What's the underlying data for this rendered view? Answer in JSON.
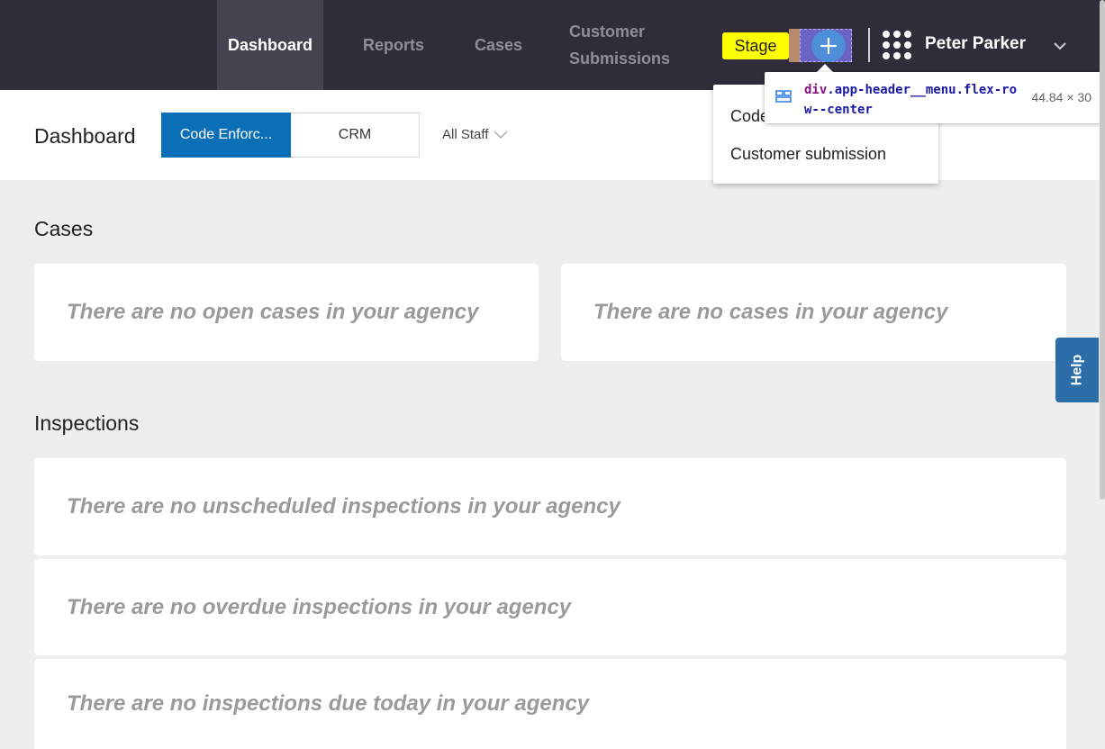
{
  "header": {
    "nav": [
      {
        "label": "Dashboard",
        "active": true
      },
      {
        "label": "Reports"
      },
      {
        "label": "Cases"
      },
      {
        "label_line1": "Customer",
        "label_line2": "Submissions"
      }
    ],
    "stage_label": "Stage",
    "user_name": "Peter Parker",
    "icons": [
      "plus-icon",
      "apps-grid-icon",
      "chevron-down-icon"
    ]
  },
  "subbar": {
    "title": "Dashboard",
    "segments": [
      "Code Enforc...",
      "CRM"
    ],
    "staff_filter": "All Staff"
  },
  "add_menu": {
    "items": [
      "Code",
      "Customer submission"
    ]
  },
  "devtools_tooltip": {
    "tag": "div",
    "selector": ".app-header__menu.flex-row--center",
    "dimensions": "44.84 × 30"
  },
  "sections": {
    "cases": {
      "title": "Cases",
      "cards": [
        "There are no open cases in your agency",
        "There are no cases in your agency"
      ]
    },
    "inspections": {
      "title": "Inspections",
      "cards": [
        "There are no unscheduled inspections in your agency",
        "There are no overdue inspections in your agency",
        "There are no inspections due today in your agency"
      ]
    }
  },
  "help_label": "Help",
  "colors": {
    "header_bg": "#2f2d3a",
    "active_segment": "#0b6fb8",
    "stage_badge": "#ffff00",
    "help_tab": "#2e6ea8"
  }
}
